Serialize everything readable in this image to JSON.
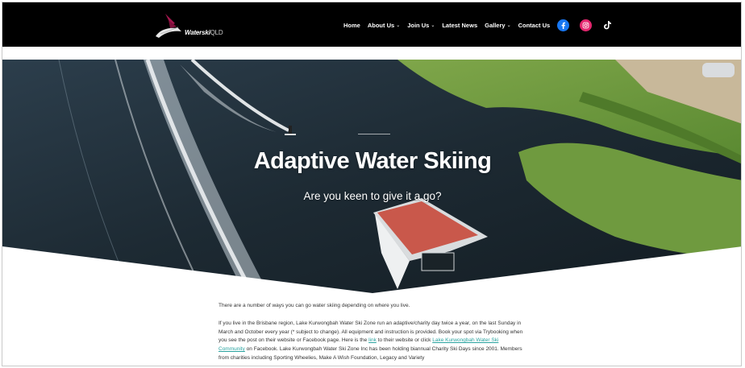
{
  "brand": {
    "logo_text_bold": "Waterski",
    "logo_text_light": "QLD"
  },
  "nav": {
    "items": [
      {
        "label": "Home",
        "dropdown": false
      },
      {
        "label": "About Us",
        "dropdown": true
      },
      {
        "label": "Join Us",
        "dropdown": true
      },
      {
        "label": "Latest News",
        "dropdown": false
      },
      {
        "label": "Gallery",
        "dropdown": true
      },
      {
        "label": "Contact Us",
        "dropdown": false
      }
    ],
    "caret": "⌄",
    "social": [
      {
        "icon": "facebook-icon",
        "color": "#1877f2"
      },
      {
        "icon": "instagram-icon",
        "color": "#e4266e"
      },
      {
        "icon": "tiktok-icon",
        "color": "#ffffff"
      }
    ]
  },
  "hero": {
    "title": "Adaptive Water Skiing",
    "subtitle": "Are you keen to give it a go?"
  },
  "content": {
    "intro": "There are a number of ways you can go water skiing depending on where you live.",
    "p2_part1": "If you live in the Brisbane region, Lake Kurwongbah Water Ski Zone run an adaptive/charity day twice a year, on the last Sunday in March and October every year (* subject to change). All equipment and instruction is provided. Book your spot via Trybooking when you see the post on their website or Facebook page. Here is the ",
    "p2_link1": "link",
    "p2_part2": " to their website or click ",
    "p2_link2": "Lake Kurwongbah Water Ski Community",
    "p2_part3": " on Facebook. Lake Kurwongbah Water Ski Zone Inc has been holding biannual Charity Ski Days since 2001. Members from charities including Sporting Wheelies, Make A Wish Foundation, Legacy and Variety"
  },
  "colors": {
    "header_bg": "#000000",
    "accent_link": "#2aa3a0",
    "logo_magenta": "#a3174d"
  }
}
